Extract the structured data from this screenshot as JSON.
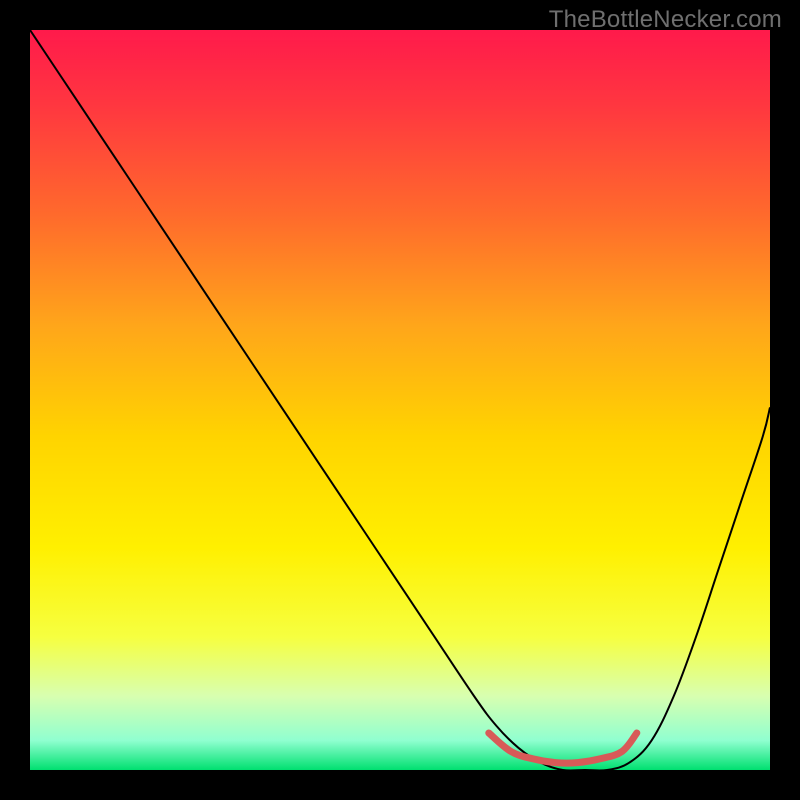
{
  "watermark": "TheBottleNecker.com",
  "chart_data": {
    "type": "line",
    "title": "",
    "xlabel": "",
    "ylabel": "",
    "xlim": [
      0,
      100
    ],
    "ylim": [
      0,
      100
    ],
    "background_gradient": {
      "stops": [
        {
          "offset": 0.0,
          "color": "#ff1a4b"
        },
        {
          "offset": 0.1,
          "color": "#ff3640"
        },
        {
          "offset": 0.25,
          "color": "#ff6a2c"
        },
        {
          "offset": 0.4,
          "color": "#ffa61a"
        },
        {
          "offset": 0.55,
          "color": "#ffd400"
        },
        {
          "offset": 0.7,
          "color": "#fff000"
        },
        {
          "offset": 0.82,
          "color": "#f6ff40"
        },
        {
          "offset": 0.9,
          "color": "#d8ffb0"
        },
        {
          "offset": 0.96,
          "color": "#90ffd0"
        },
        {
          "offset": 1.0,
          "color": "#00e070"
        }
      ]
    },
    "series": [
      {
        "name": "bottleneck-curve",
        "type": "line",
        "stroke": "#000000",
        "stroke_width": 2,
        "x": [
          0,
          6,
          12,
          18,
          24,
          30,
          36,
          42,
          48,
          54,
          60,
          63,
          66,
          69,
          72,
          75,
          78,
          81,
          84,
          87,
          90,
          93,
          96,
          99,
          100
        ],
        "y": [
          100,
          91,
          82,
          73,
          64,
          55,
          46,
          37,
          28,
          19,
          10,
          6,
          3,
          1,
          0,
          0,
          0,
          1,
          4,
          10,
          18,
          27,
          36,
          45,
          49
        ]
      },
      {
        "name": "optimal-band",
        "type": "line",
        "stroke": "#d85a58",
        "stroke_width": 7,
        "linecap": "round",
        "x": [
          62,
          65,
          68,
          71,
          74,
          77,
          80,
          82
        ],
        "y": [
          5,
          2.5,
          1.5,
          1,
          1,
          1.5,
          2.5,
          5
        ]
      }
    ]
  }
}
